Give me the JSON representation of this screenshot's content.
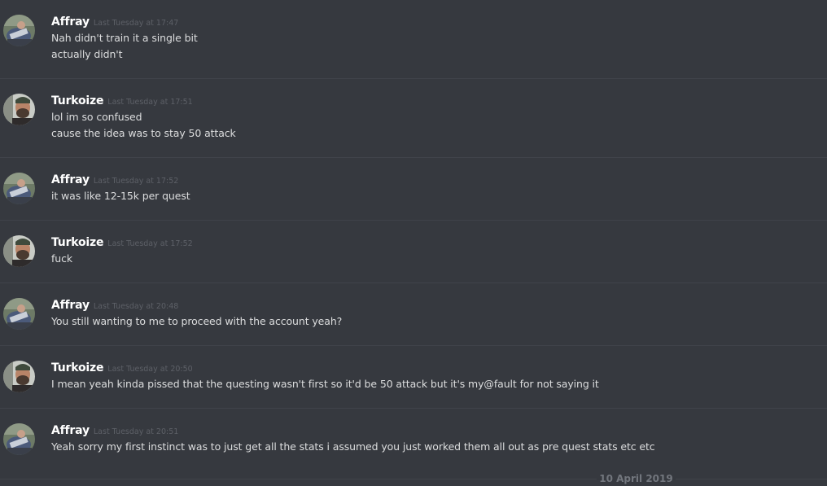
{
  "messages": [
    {
      "author": "Affray",
      "avatar": "affray-avatar",
      "timestamp": "Last Tuesday at 17:47",
      "lines": [
        "Nah didn't train it a single bit",
        "actually didn't"
      ]
    },
    {
      "author": "Turkoize",
      "avatar": "turkoize-avatar",
      "timestamp": "Last Tuesday at 17:51",
      "lines": [
        "lol im so confused",
        "cause the idea was to stay 50 attack"
      ]
    },
    {
      "author": "Affray",
      "avatar": "affray-avatar",
      "timestamp": "Last Tuesday at 17:52",
      "lines": [
        "it was like 12-15k per quest"
      ]
    },
    {
      "author": "Turkoize",
      "avatar": "turkoize-avatar",
      "timestamp": "Last Tuesday at 17:52",
      "lines": [
        "fuck"
      ]
    },
    {
      "author": "Affray",
      "avatar": "affray-avatar",
      "timestamp": "Last Tuesday at 20:48",
      "lines": [
        "You still wanting to me to proceed with the account yeah?"
      ]
    },
    {
      "author": "Turkoize",
      "avatar": "turkoize-avatar",
      "timestamp": "Last Tuesday at 20:50",
      "lines": [
        "I mean yeah kinda pissed that the questing wasn't first so it'd be 50 attack but it's my@fault for not saying it"
      ]
    },
    {
      "author": "Affray",
      "avatar": "affray-avatar",
      "timestamp": "Last Tuesday at 20:51",
      "lines": [
        "Yeah sorry my first instinct was to just get all the stats i assumed you just worked them all out as pre quest stats etc etc"
      ]
    }
  ],
  "date_separator": "10 April 2019",
  "colors": {
    "background": "#36393f",
    "username": "#ffffff",
    "text": "#dcddde",
    "timestamp": "#5d6067",
    "divider": "#40434a"
  }
}
